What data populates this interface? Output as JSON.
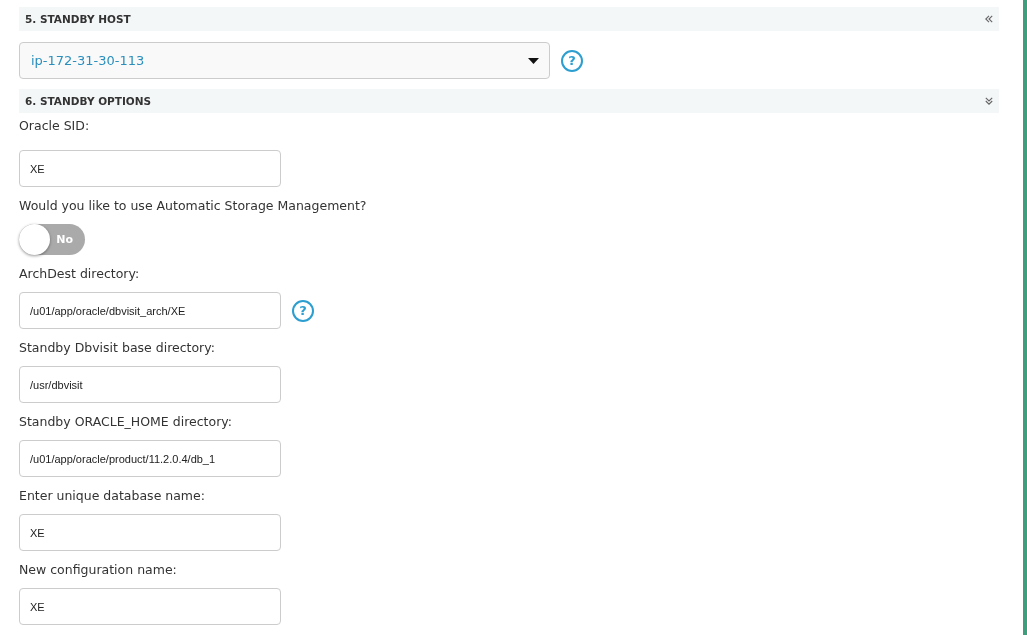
{
  "sections": [
    {
      "title": "5. STANDBY HOST",
      "expanded": false,
      "fields": [
        {
          "kind": "select",
          "value": "ip-172-31-30-113",
          "help": "?"
        }
      ]
    },
    {
      "title": "6. STANDBY OPTIONS",
      "expanded": true,
      "fields": [
        {
          "kind": "text",
          "label": "Oracle SID:",
          "value": "XE"
        },
        {
          "kind": "toggle",
          "label": "Would you like to use Automatic Storage Management?",
          "on": false,
          "state_label": "No"
        },
        {
          "kind": "text",
          "label": "ArchDest directory:",
          "value": "/u01/app/oracle/dbvisit_arch/XE",
          "help": "?"
        },
        {
          "kind": "text",
          "label": "Standby Dbvisit base directory:",
          "value": "/usr/dbvisit"
        },
        {
          "kind": "text",
          "label": "Standby ORACLE_HOME directory:",
          "value": "/u01/app/oracle/product/11.2.0.4/db_1"
        },
        {
          "kind": "text",
          "label": "Enter unique database name:",
          "value": "XE"
        },
        {
          "kind": "text",
          "label": "New configuration name:",
          "value": "XE"
        }
      ]
    }
  ]
}
